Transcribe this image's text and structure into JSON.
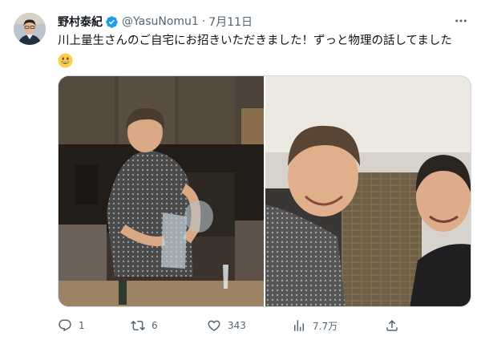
{
  "user": {
    "display_name": "野村泰紀",
    "handle": "@YasuNomu1",
    "separator": "·",
    "date": "7月11日",
    "verified": true
  },
  "tweet": {
    "text": "川上量生さんのご自宅にお招きいただきました！ずっと物理の話してました",
    "emoji": "grinning-face-emoji"
  },
  "media": {
    "count": 2
  },
  "stats": {
    "replies": "1",
    "retweets": "6",
    "likes": "343",
    "views": "7.7万"
  },
  "icons": {
    "more": "more-icon",
    "reply": "reply-icon",
    "retweet": "retweet-icon",
    "like": "like-icon",
    "views": "views-icon",
    "share": "share-icon",
    "verified": "verified-badge-icon"
  },
  "colors": {
    "text": "#0f1419",
    "secondary": "#536471",
    "verified": "#1d9bf0",
    "border": "#cfd9de"
  }
}
